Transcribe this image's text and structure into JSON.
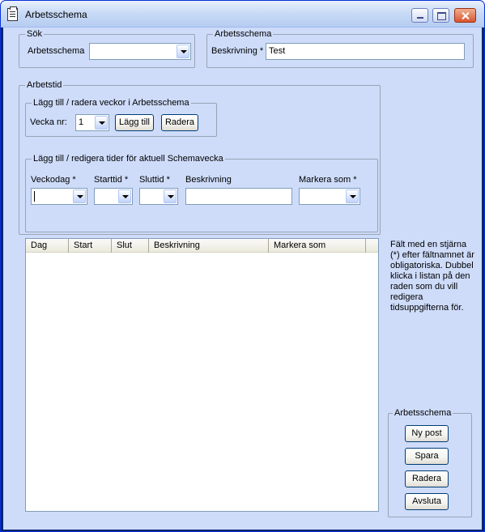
{
  "window": {
    "title": "Arbetsschema"
  },
  "sok": {
    "group_label": "Sök",
    "arbetsschema_label": "Arbetsschema",
    "arbetsschema_value": ""
  },
  "arbetsschema": {
    "group_label": "Arbetsschema",
    "beskrivning_label": "Beskrivning *",
    "beskrivning_value": "Test"
  },
  "arbetstid": {
    "group_label": "Arbetstid",
    "veckor": {
      "group_label": "Lägg till / radera veckor i Arbetsschema",
      "vecka_label": "Vecka nr:",
      "vecka_value": "1",
      "add_label": "Lägg till",
      "delete_label": "Radera"
    },
    "tider": {
      "group_label": "Lägg till / redigera tider för aktuell Schemavecka",
      "veckodag_label": "Veckodag *",
      "starttid_label": "Starttid *",
      "sluttid_label": "Sluttid *",
      "beskrivning_label": "Beskrivning",
      "markera_label": "Markera som *",
      "veckodag_value": "",
      "starttid_value": "",
      "sluttid_value": "",
      "beskrivning_value": "",
      "markera_value": ""
    }
  },
  "table": {
    "columns": [
      "Dag",
      "Start",
      "Slut",
      "Beskrivning",
      "Markera som"
    ],
    "rows": []
  },
  "info_text": "Fält med en stjärna (*) efter fältnamnet är obligatoriska. Dubbel klicka i listan  på den raden som du vill redigera tidsuppgifterna för.",
  "actions": {
    "group_label": "Arbetsschema",
    "new_label": "Ny post",
    "save_label": "Spara",
    "delete_label": "Radera",
    "exit_label": "Avsluta"
  }
}
